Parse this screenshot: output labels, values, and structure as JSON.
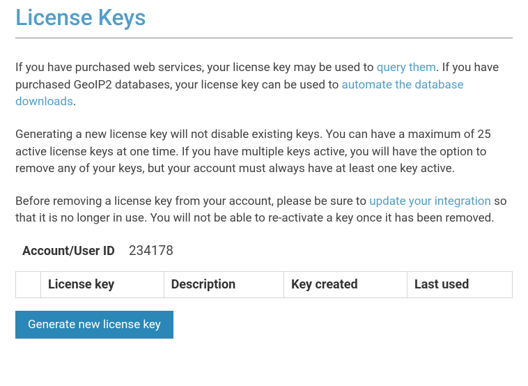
{
  "page": {
    "title": "License Keys"
  },
  "intro": {
    "p1_before": "If you have purchased web services, your license key may be used to ",
    "p1_link1": "query them",
    "p1_mid": ". If you have purchased GeoIP2 databases, your license key can be used to ",
    "p1_link2": "automate the database downloads",
    "p1_after": ".",
    "p2": "Generating a new license key will not disable existing keys. You can have a maximum of 25 active license keys at one time. If you have multiple keys active, you will have the option to remove any of your keys, but your account must always have at least one key active.",
    "p3_before": "Before removing a license key from your account, please be sure to ",
    "p3_link": "update your integration",
    "p3_after": " so that it is no longer in use. You will not be able to re-activate a key once it has been removed."
  },
  "account": {
    "label": "Account/User ID",
    "value": "234178"
  },
  "table": {
    "headers": {
      "blank": "",
      "license_key": "License key",
      "description": "Description",
      "key_created": "Key created",
      "last_used": "Last used"
    }
  },
  "actions": {
    "generate_label": "Generate new license key"
  }
}
